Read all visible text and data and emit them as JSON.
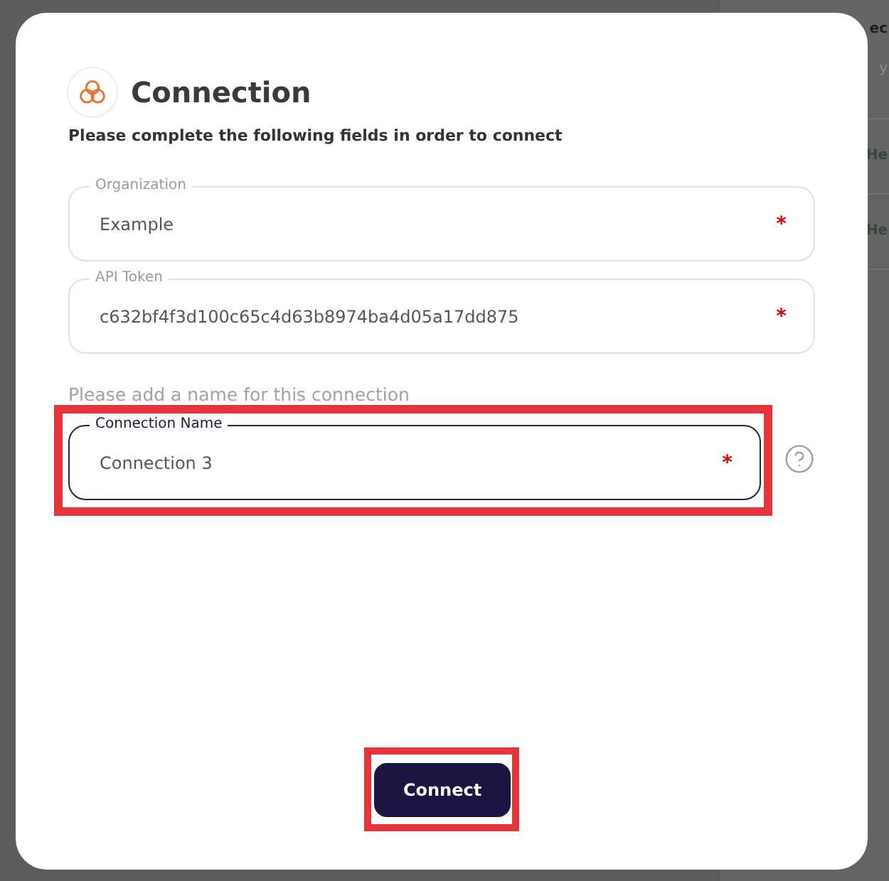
{
  "background_panel": {
    "items": [
      {
        "kind": "heading",
        "text": "ec"
      },
      {
        "kind": "subtext",
        "text": "y"
      },
      {
        "kind": "link",
        "text": "He"
      },
      {
        "kind": "link",
        "text": "He"
      }
    ]
  },
  "dialog": {
    "title": "Connection",
    "subtitle": "Please complete the following fields in order to connect",
    "items": [
      {
        "kind": "field",
        "label": "Organization",
        "value": "Example",
        "required_mark": "*",
        "focused": false,
        "highlighted": false,
        "help": false
      },
      {
        "kind": "field",
        "label": "API Token",
        "value": "c632bf4f3d100c65c4d63b8974ba4d05a17dd875",
        "required_mark": "*",
        "focused": false,
        "highlighted": false,
        "help": false
      },
      {
        "kind": "prompt",
        "text": "Please add a name for this connection"
      },
      {
        "kind": "field",
        "label": "Connection Name",
        "value": "Connection 3",
        "required_mark": "*",
        "focused": true,
        "highlighted": true,
        "help": true
      }
    ],
    "connect_button": {
      "label": "Connect",
      "highlighted": true
    }
  }
}
